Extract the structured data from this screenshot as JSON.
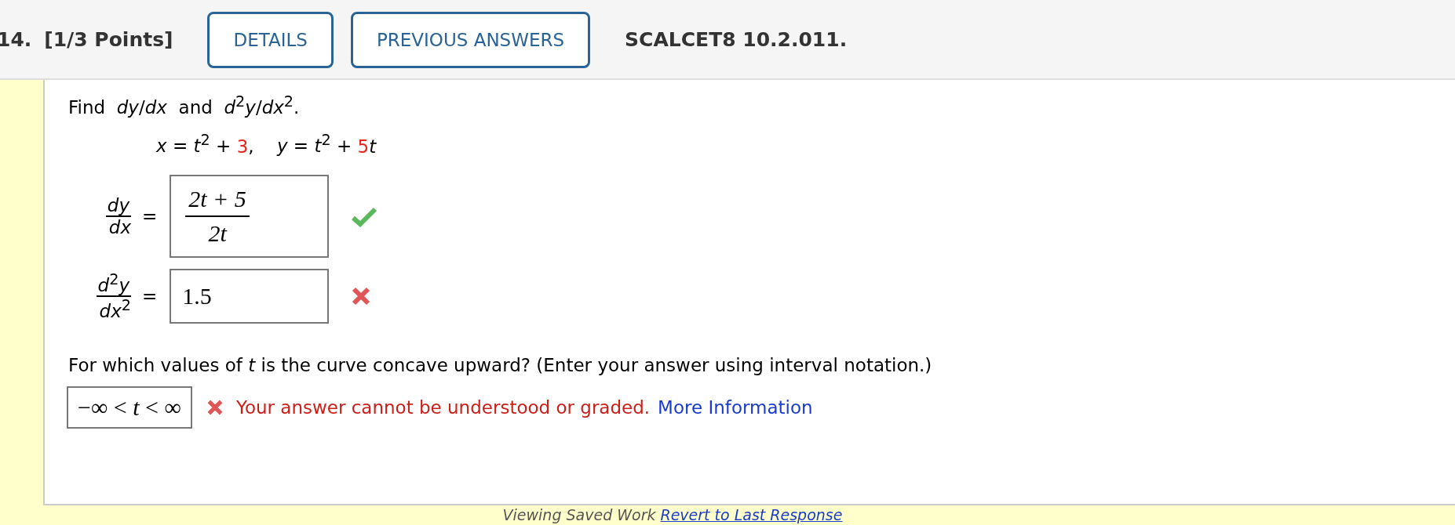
{
  "header": {
    "number": "14.",
    "points": "[1/3 Points]",
    "buttons": [
      "DETAILS",
      "PREVIOUS ANSWERS"
    ],
    "code": "SCALCET8 10.2.011."
  },
  "question": {
    "prompt": "Find  *dy*/*dx*  and  *d*$^{2}$*y*/*dx*$^{2}$.",
    "equation": [
      {
        "text": "*x* = *t*$^{2}$ + ",
        "randomized": false
      },
      {
        "text": "3",
        "randomized": true
      },
      {
        "text": ",    *y* = *t*$^{2}$ + ",
        "randomized": false
      },
      {
        "text": "5",
        "randomized": true
      },
      {
        "text": "*t*",
        "randomized": false
      }
    ],
    "answers": [
      {
        "kind": "fraction",
        "label_num": "*dy*",
        "label_den": "*dx*",
        "relation": "=",
        "numerator": "2t + 5",
        "denominator": "2t",
        "correct": true
      },
      {
        "kind": "plain",
        "label_num": "*d*$^{2}$*y*",
        "label_den": "*dx*$^{2}$",
        "relation": "=",
        "value": "1.5",
        "correct": false
      }
    ],
    "part2": {
      "prompt": "For which values of *t* is the curve concave upward? (Enter your answer using interval notation.)",
      "value": "−∞ < *t* < ∞",
      "correct": false,
      "feedback": "Your answer cannot be understood or graded.",
      "link": "More Information"
    }
  },
  "footer": {
    "status": "Viewing Saved Work",
    "link": "Revert to Last Response"
  }
}
